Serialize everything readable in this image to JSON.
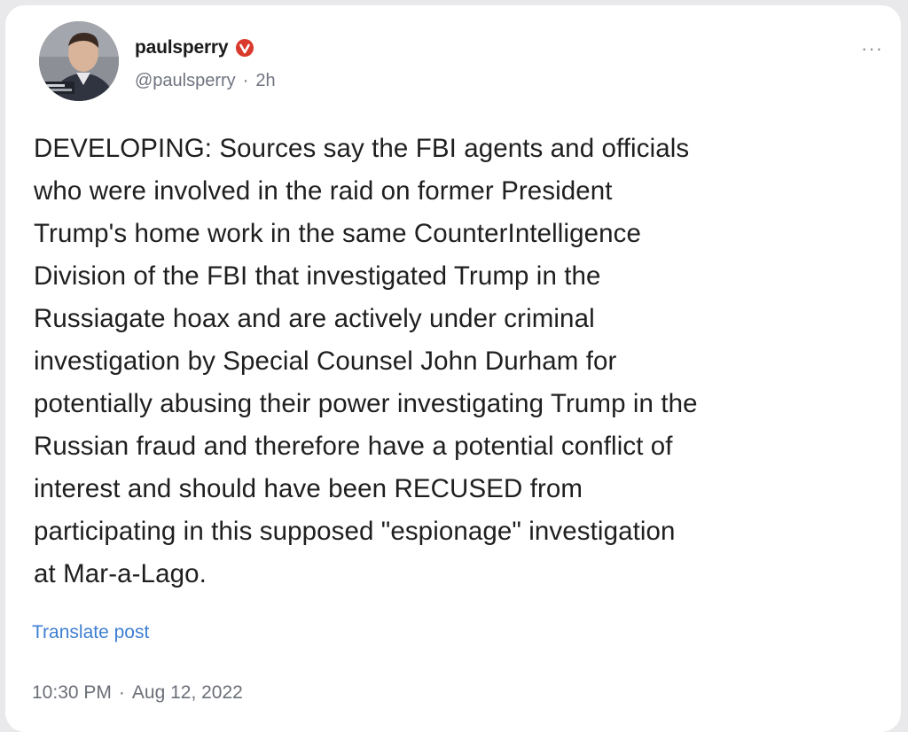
{
  "author": {
    "display_name": "paulsperry",
    "handle": "@paulsperry",
    "separator": "·",
    "relative_time": "2h",
    "avatar_icon": "profile-photo",
    "verified_icon": "verified-badge-icon",
    "verified_color": "#d93a2b"
  },
  "post": {
    "text": "DEVELOPING: Sources say the FBI agents and officials\nwho were involved in the raid on former President\nTrump's home work in the same CounterIntelligence\nDivision of the FBI that investigated Trump in the\nRussiagate hoax and are actively under criminal\ninvestigation by Special Counsel John Durham for\npotentially abusing their power investigating Trump in the\nRussian fraud and therefore have a potential conflict of\ninterest and should have been RECUSED from\nparticipating in this supposed \"espionage\" investigation\nat Mar-a-Lago.",
    "translate_label": "Translate post",
    "time": "10:30 PM",
    "date_separator": "·",
    "date": "Aug 12, 2022"
  },
  "more_icon": "more-options-icon",
  "colors": {
    "link": "#3e7fd2",
    "muted": "#6f7480",
    "text": "#1f1f1f"
  }
}
